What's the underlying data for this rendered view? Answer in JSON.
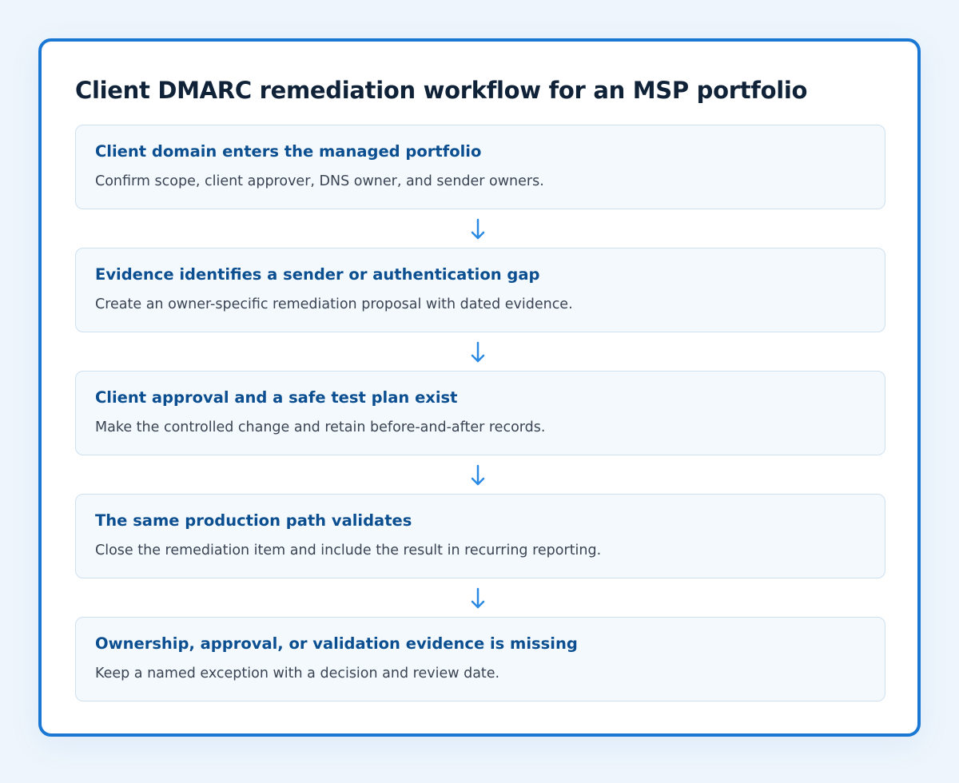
{
  "diagram": {
    "title": "Client DMARC remediation workflow for an MSP portfolio",
    "steps": [
      {
        "title": "Client domain enters the managed portfolio",
        "description": "Confirm scope, client approver, DNS owner, and sender owners."
      },
      {
        "title": "Evidence identifies a sender or authentication gap",
        "description": "Create an owner-specific remediation proposal with dated evidence."
      },
      {
        "title": "Client approval and a safe test plan exist",
        "description": "Make the controlled change and retain before-and-after records."
      },
      {
        "title": "The same production path validates",
        "description": "Close the remediation item and include the result in recurring reporting."
      },
      {
        "title": "Ownership, approval, or validation evidence is missing",
        "description": "Keep a named exception with a decision and review date."
      }
    ],
    "colors": {
      "frame_border": "#1a78d4",
      "step_title": "#0c4f91",
      "arrow": "#2b8ae4",
      "step_background": "#f4f9fe"
    }
  }
}
